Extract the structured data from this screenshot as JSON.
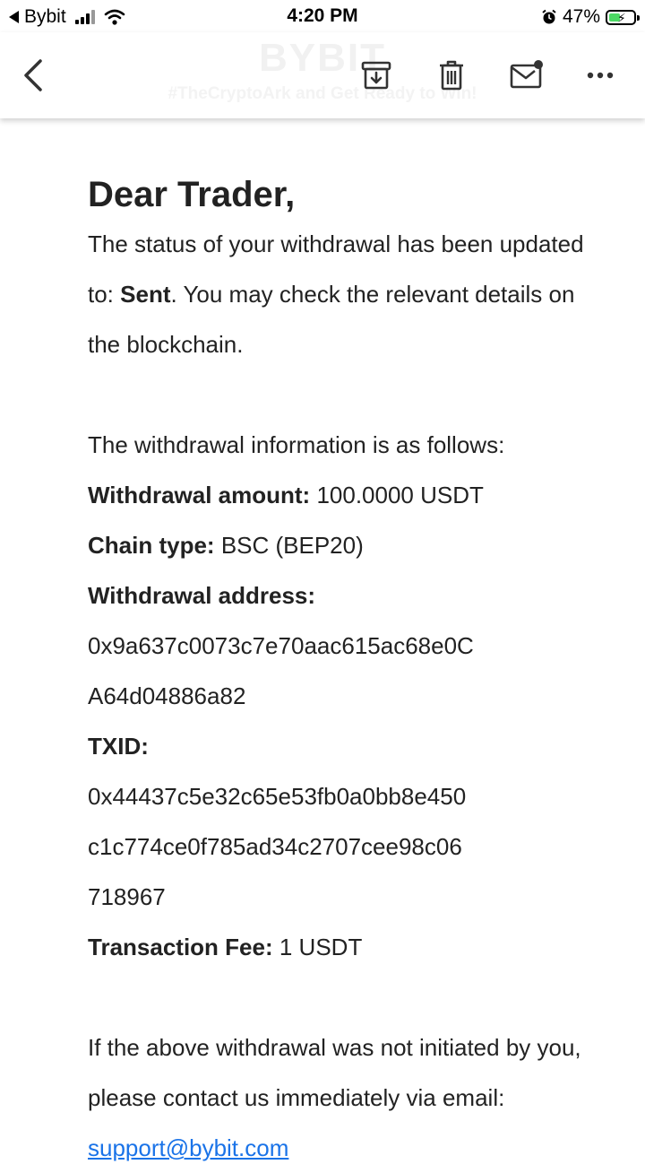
{
  "status_bar": {
    "back_app": "Bybit",
    "time": "4:20 PM",
    "battery": "47%",
    "battery_level": 0.47
  },
  "toolbar": {
    "brand": "BYBIT",
    "tagline": "#TheCryptoArk and Get Ready to Win!",
    "icons": [
      "back-icon",
      "archive-icon",
      "delete-icon",
      "mark-unread-icon",
      "more-icon"
    ]
  },
  "email": {
    "greeting": "Dear Trader,",
    "status_prefix": "The status of your withdrawal has been updated to: ",
    "status_value": "Sent",
    "status_suffix": ". You may check the relevant details on the blockchain.",
    "info_intro": "The withdrawal information is as follows:",
    "amount_label": "Withdrawal amount:",
    "amount_value": "100.0000 USDT",
    "chain_label": "Chain type:",
    "chain_value": "BSC (BEP20)",
    "address_label": "Withdrawal address:",
    "address_line1": "0x9a637c0073c7e70aac615ac68e0C",
    "address_line2": "A64d04886a82",
    "txid_label": "TXID:",
    "txid_line1": "0x44437c5e32c65e53fb0a0bb8e450",
    "txid_line2": "c1c774ce0f785ad34c2707cee98c06",
    "txid_line3": "718967",
    "fee_label": "Transaction Fee:",
    "fee_value": "1 USDT",
    "closing_text": "If the above withdrawal was not initiated by you, please contact us immediately via email: ",
    "support_email": "support@bybit.com"
  }
}
